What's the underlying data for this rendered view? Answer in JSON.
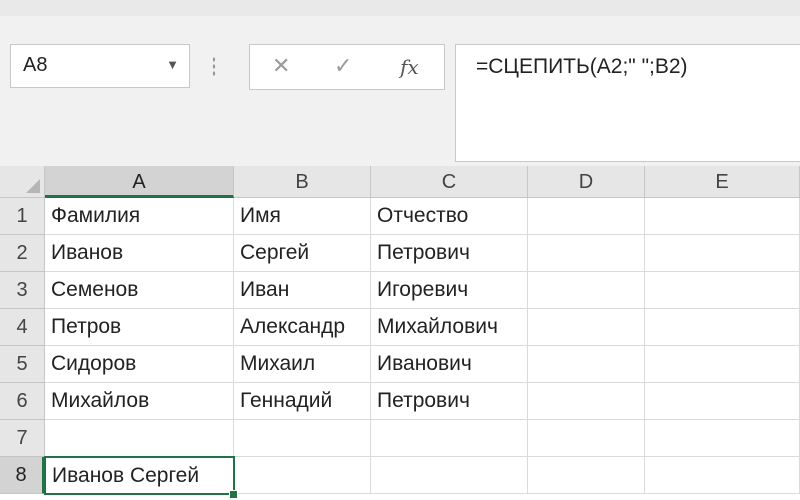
{
  "name_box": {
    "value": "A8"
  },
  "formula_bar": {
    "cancel_glyph": "✕",
    "enter_glyph": "✓",
    "fx_label": "fx",
    "formula": "=СЦЕПИТЬ(A2;\" \";B2)"
  },
  "columns": [
    "A",
    "B",
    "C",
    "D",
    "E"
  ],
  "rows": [
    {
      "num": "1",
      "a": "Фамилия",
      "b": "Имя",
      "c": "Отчество"
    },
    {
      "num": "2",
      "a": "Иванов",
      "b": "Сергей",
      "c": "Петрович"
    },
    {
      "num": "3",
      "a": "Семенов",
      "b": "Иван",
      "c": "Игоревич"
    },
    {
      "num": "4",
      "a": "Петров",
      "b": "Александр",
      "c": "Михайлович"
    },
    {
      "num": "5",
      "a": "Сидоров",
      "b": "Михаил",
      "c": "Иванович"
    },
    {
      "num": "6",
      "a": "Михайлов",
      "b": "Геннадий",
      "c": "Петрович"
    },
    {
      "num": "7",
      "a": "",
      "b": "",
      "c": ""
    },
    {
      "num": "8",
      "a": "Иванов Сергей",
      "b": "",
      "c": ""
    }
  ],
  "colors": {
    "accent": "#217346"
  }
}
